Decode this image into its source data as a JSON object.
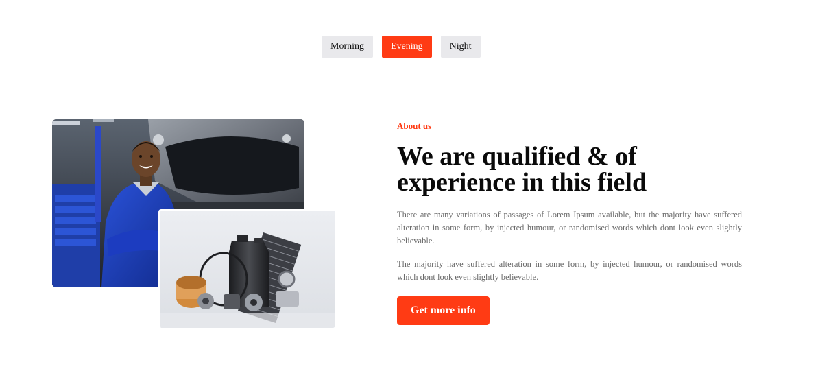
{
  "tabs": [
    {
      "label": "Morning",
      "active": false
    },
    {
      "label": "Evening",
      "active": true
    },
    {
      "label": "Night",
      "active": false
    }
  ],
  "about": {
    "eyebrow": "About us",
    "headline": "We are qualified & of experience in this field",
    "paragraph_1": "There are many variations of passages of Lorem Ipsum available, but the majority have suffered alteration in some form, by injected humour, or randomised words which dont look even slightly believable.",
    "paragraph_2": "The majority have suffered alteration in some form, by injected humour, or randomised words which dont look even slightly believable.",
    "cta_label": "Get more info"
  },
  "colors": {
    "accent": "#ff3b14",
    "tab_bg": "#e9e9ec",
    "heading": "#0a0a0a",
    "body_text": "#6b6b6b"
  },
  "images": {
    "main": "mechanic-photo",
    "secondary": "auto-parts-photo"
  }
}
